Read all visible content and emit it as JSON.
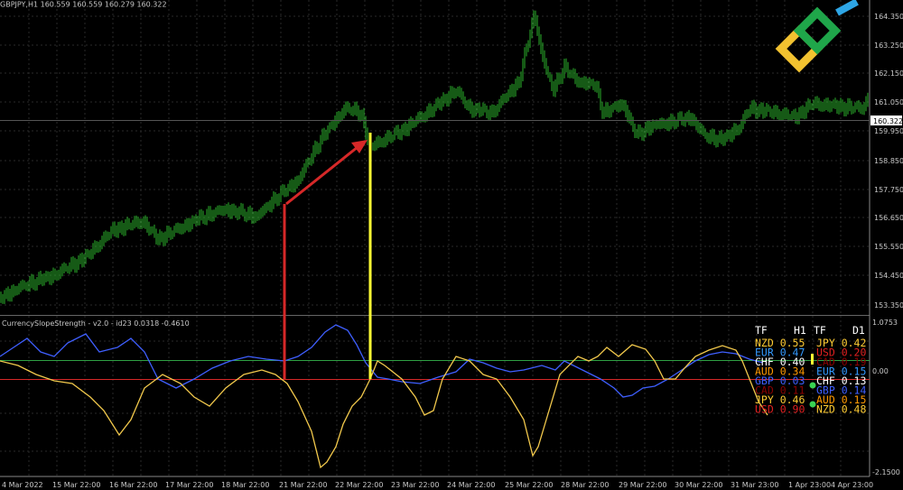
{
  "window": {
    "title": "CurrencySlopeStrength - v2.0 - id23 0.0318 -0.4610",
    "top_header": "GBPJPY,H1 160.559 160.559 160.279 160.322"
  },
  "price_axis": {
    "ticks": [
      "164.350",
      "163.250",
      "162.150",
      "161.050",
      "159.950",
      "158.850",
      "157.750",
      "156.650",
      "155.550",
      "154.450",
      "153.350"
    ],
    "current_price": "160.322"
  },
  "indicator_axis": {
    "top": "1.0753",
    "zero": "0.00",
    "bottom": "-2.1500"
  },
  "time_axis": [
    "4 Mar 2022",
    "15 Mar 22:00",
    "16 Mar 22:00",
    "17 Mar 22:00",
    "18 Mar 22:00",
    "21 Mar 22:00",
    "22 Mar 22:00",
    "23 Mar 22:00",
    "24 Mar 22:00",
    "25 Mar 22:00",
    "28 Mar 22:00",
    "29 Mar 22:00",
    "30 Mar 22:00",
    "31 Mar 23:00",
    "1 Apr 23:00",
    "4 Apr 23:00"
  ],
  "strength_table": {
    "headers": [
      "TF",
      "H1",
      "TF",
      "D1"
    ],
    "rows": [
      {
        "l_name": "NZD",
        "l_val": "0.55",
        "l_color": "#ffcc33",
        "r_name": "JPY",
        "r_val": "0.42",
        "r_color": "#ffcc33"
      },
      {
        "l_name": "EUR",
        "l_val": "0.47",
        "l_color": "#3399ff",
        "r_name": "USD",
        "r_val": "0.20",
        "r_color": "#e02020"
      },
      {
        "l_name": "CHF",
        "l_val": "0.40",
        "l_color": "#ffffff",
        "r_name": "CAD",
        "r_val": "0.19",
        "r_color": "#8b0000"
      },
      {
        "l_name": "AUD",
        "l_val": "0.34",
        "l_color": "#ff9900",
        "r_name": "EUR",
        "r_val": "0.15",
        "r_color": "#3399ff"
      },
      {
        "l_name": "GBP",
        "l_val": "0.03",
        "l_color": "#3f5fff",
        "r_name": "CHF",
        "r_val": "0.13",
        "r_color": "#ffffff"
      },
      {
        "l_name": "CAD",
        "l_val": "0.11",
        "l_color": "#8b0000",
        "r_name": "GBP",
        "r_val": "0.14",
        "r_color": "#3f5fff"
      },
      {
        "l_name": "JPY",
        "l_val": "0.46",
        "l_color": "#ffcc33",
        "r_name": "AUD",
        "r_val": "0.15",
        "r_color": "#ff9900"
      },
      {
        "l_name": "USD",
        "l_val": "0.90",
        "l_color": "#e02020",
        "r_name": "NZD",
        "r_val": "0.48",
        "r_color": "#ffcc33"
      }
    ]
  },
  "colors": {
    "candles": "#2db52d",
    "jpy_line": "#f2c94c",
    "gbp_line": "#3f5fff",
    "level_upper": "#2ea043",
    "level_lower": "#d62828",
    "arrow": "#d62828",
    "marker": "#ffff33",
    "grid": "#2a2a2a"
  },
  "logo": {
    "name": "litefinance-logo-icon"
  }
}
